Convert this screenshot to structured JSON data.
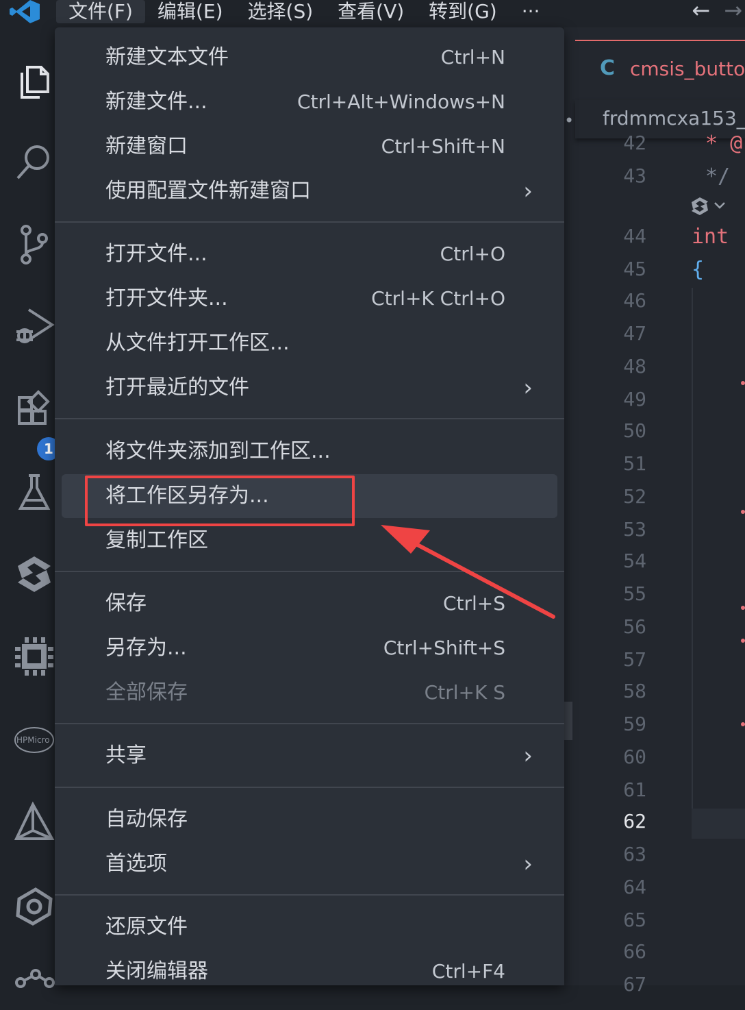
{
  "menubar": {
    "items": [
      "文件(F)",
      "编辑(E)",
      "选择(S)",
      "查看(V)",
      "转到(G)",
      "···"
    ],
    "active_index": 0
  },
  "activity": {
    "extensions_badge": "1",
    "hpm_label": "HPMicro"
  },
  "file_menu": {
    "groups": [
      [
        {
          "label": "新建文本文件",
          "shortcut": "Ctrl+N"
        },
        {
          "label": "新建文件...",
          "shortcut": "Ctrl+Alt+Windows+N"
        },
        {
          "label": "新建窗口",
          "shortcut": "Ctrl+Shift+N"
        },
        {
          "label": "使用配置文件新建窗口",
          "submenu": true
        }
      ],
      [
        {
          "label": "打开文件...",
          "shortcut": "Ctrl+O"
        },
        {
          "label": "打开文件夹...",
          "shortcut": "Ctrl+K Ctrl+O"
        },
        {
          "label": "从文件打开工作区..."
        },
        {
          "label": "打开最近的文件",
          "submenu": true
        }
      ],
      [
        {
          "label": "将文件夹添加到工作区..."
        },
        {
          "label": "将工作区另存为...",
          "hover": true
        },
        {
          "label": "复制工作区"
        }
      ],
      [
        {
          "label": "保存",
          "shortcut": "Ctrl+S"
        },
        {
          "label": "另存为...",
          "shortcut": "Ctrl+Shift+S"
        },
        {
          "label": "全部保存",
          "shortcut": "Ctrl+K S",
          "disabled": true
        }
      ],
      [
        {
          "label": "共享",
          "submenu": true
        }
      ],
      [
        {
          "label": "自动保存"
        },
        {
          "label": "首选项",
          "submenu": true
        }
      ],
      [
        {
          "label": "还原文件"
        },
        {
          "label": "关闭编辑器",
          "shortcut": "Ctrl+F4"
        }
      ]
    ],
    "submenu_arrow": "›"
  },
  "editor": {
    "tab_lang": "C",
    "tab_name": "cmsis_butto",
    "breadcrumb": "frdmmcxa153_",
    "breadcrumb_dot": "•",
    "line_numbers": [
      "42",
      "43",
      "44",
      "45",
      "46",
      "47",
      "48",
      "49",
      "50",
      "51",
      "52",
      "53",
      "54",
      "55",
      "56",
      "57",
      "58",
      "59",
      "60",
      "61",
      "62",
      "63",
      "64",
      "65",
      "66",
      "67"
    ],
    "current_line": "62",
    "code": {
      "line42": "* @",
      "line43": "*/",
      "line44": "int",
      "line45": "{"
    }
  },
  "colors": {
    "highlight": "#ef4444",
    "menu_bg": "#2b3038",
    "accent": "#2f74d0"
  }
}
